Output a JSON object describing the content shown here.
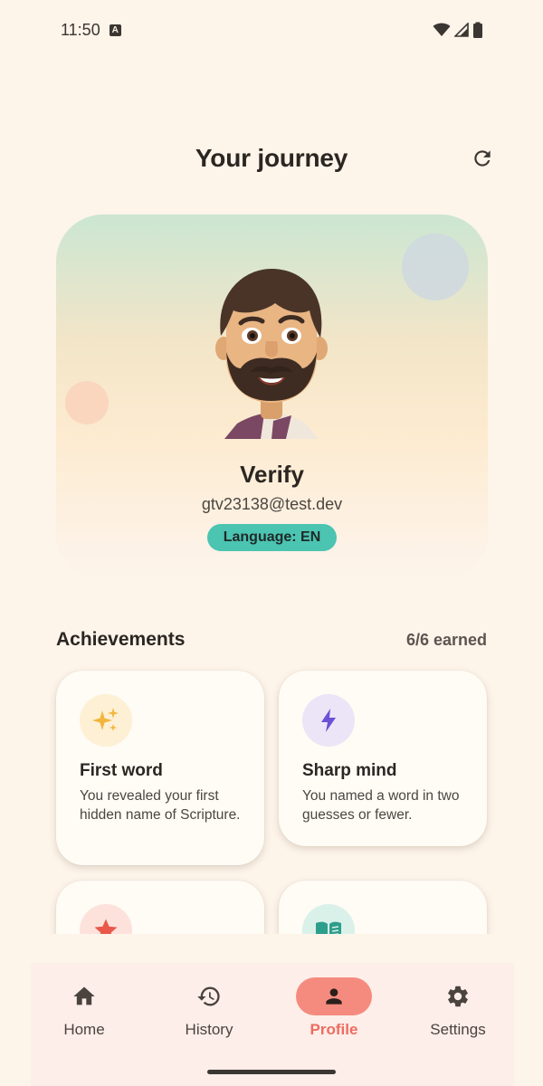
{
  "status_bar": {
    "time": "11:50",
    "notification_badge": "A"
  },
  "header": {
    "title": "Your journey",
    "refresh_icon": "refresh-icon"
  },
  "profile": {
    "name": "Verify",
    "email": "gtv23138@test.dev",
    "language_badge": "Language: EN",
    "avatar_icon": "avatar-bearded-man"
  },
  "achievements": {
    "title": "Achievements",
    "count": "6/6 earned",
    "items": [
      {
        "name": "First word",
        "description": "You revealed your first hidden name of Scripture.",
        "icon": "sparkles-icon",
        "icon_bg": "#fdf0d4",
        "icon_color": "#f2b63c"
      },
      {
        "name": "Sharp mind",
        "description": "You named a word in two guesses or fewer.",
        "icon": "lightning-bolt-icon",
        "icon_bg": "#ebe5f7",
        "icon_color": "#6a52d6"
      },
      {
        "name": "",
        "description": "",
        "icon": "star-icon",
        "icon_bg": "#fde2dc",
        "icon_color": "#e9584a"
      },
      {
        "name": "",
        "description": "",
        "icon": "open-book-icon",
        "icon_bg": "#daf1ea",
        "icon_color": "#2e9e8c"
      }
    ]
  },
  "bottom_nav": {
    "items": [
      {
        "label": "Home",
        "icon": "home-icon",
        "active": false
      },
      {
        "label": "History",
        "icon": "history-icon",
        "active": false
      },
      {
        "label": "Profile",
        "icon": "person-icon",
        "active": true
      },
      {
        "label": "Settings",
        "icon": "gear-icon",
        "active": false
      }
    ]
  },
  "colors": {
    "background": "#fdf4ea",
    "accent": "#ee6b5f",
    "active_pill": "#f58b7e",
    "language_badge": "#4cc4b2",
    "nav_background": "#fdeee9"
  }
}
